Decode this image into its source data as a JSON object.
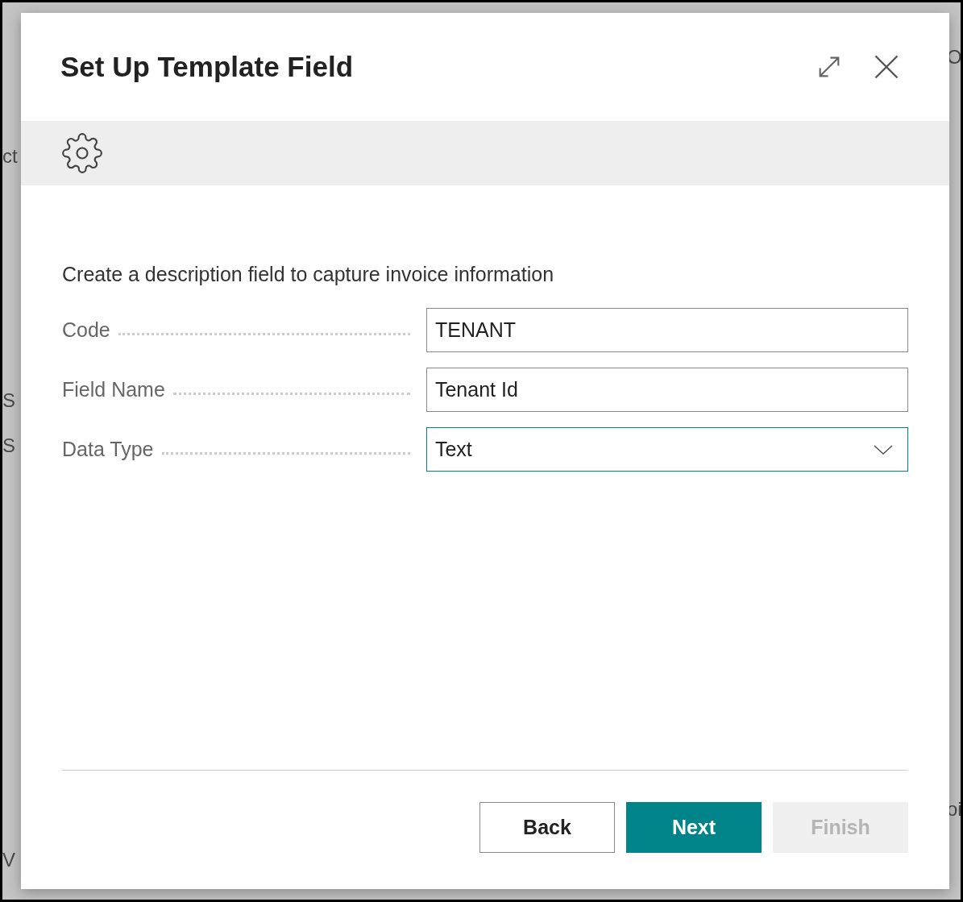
{
  "background": {
    "left_fragments": [
      "ct",
      "S",
      "S",
      "V"
    ],
    "right_fragments": [
      "O",
      "oi"
    ]
  },
  "dialog": {
    "title": "Set Up Template Field",
    "instruction": "Create a description field to capture invoice information",
    "fields": [
      {
        "label": "Code",
        "value": "TENANT",
        "kind": "text",
        "focused": false
      },
      {
        "label": "Field Name",
        "value": "Tenant Id",
        "kind": "text",
        "focused": false
      },
      {
        "label": "Data Type",
        "value": "Text",
        "kind": "dropdown",
        "focused": true
      }
    ],
    "buttons": [
      {
        "label": "Back",
        "kind": "secondary",
        "disabled": false
      },
      {
        "label": "Next",
        "kind": "primary",
        "disabled": false
      },
      {
        "label": "Finish",
        "kind": "secondary",
        "disabled": true
      }
    ]
  }
}
